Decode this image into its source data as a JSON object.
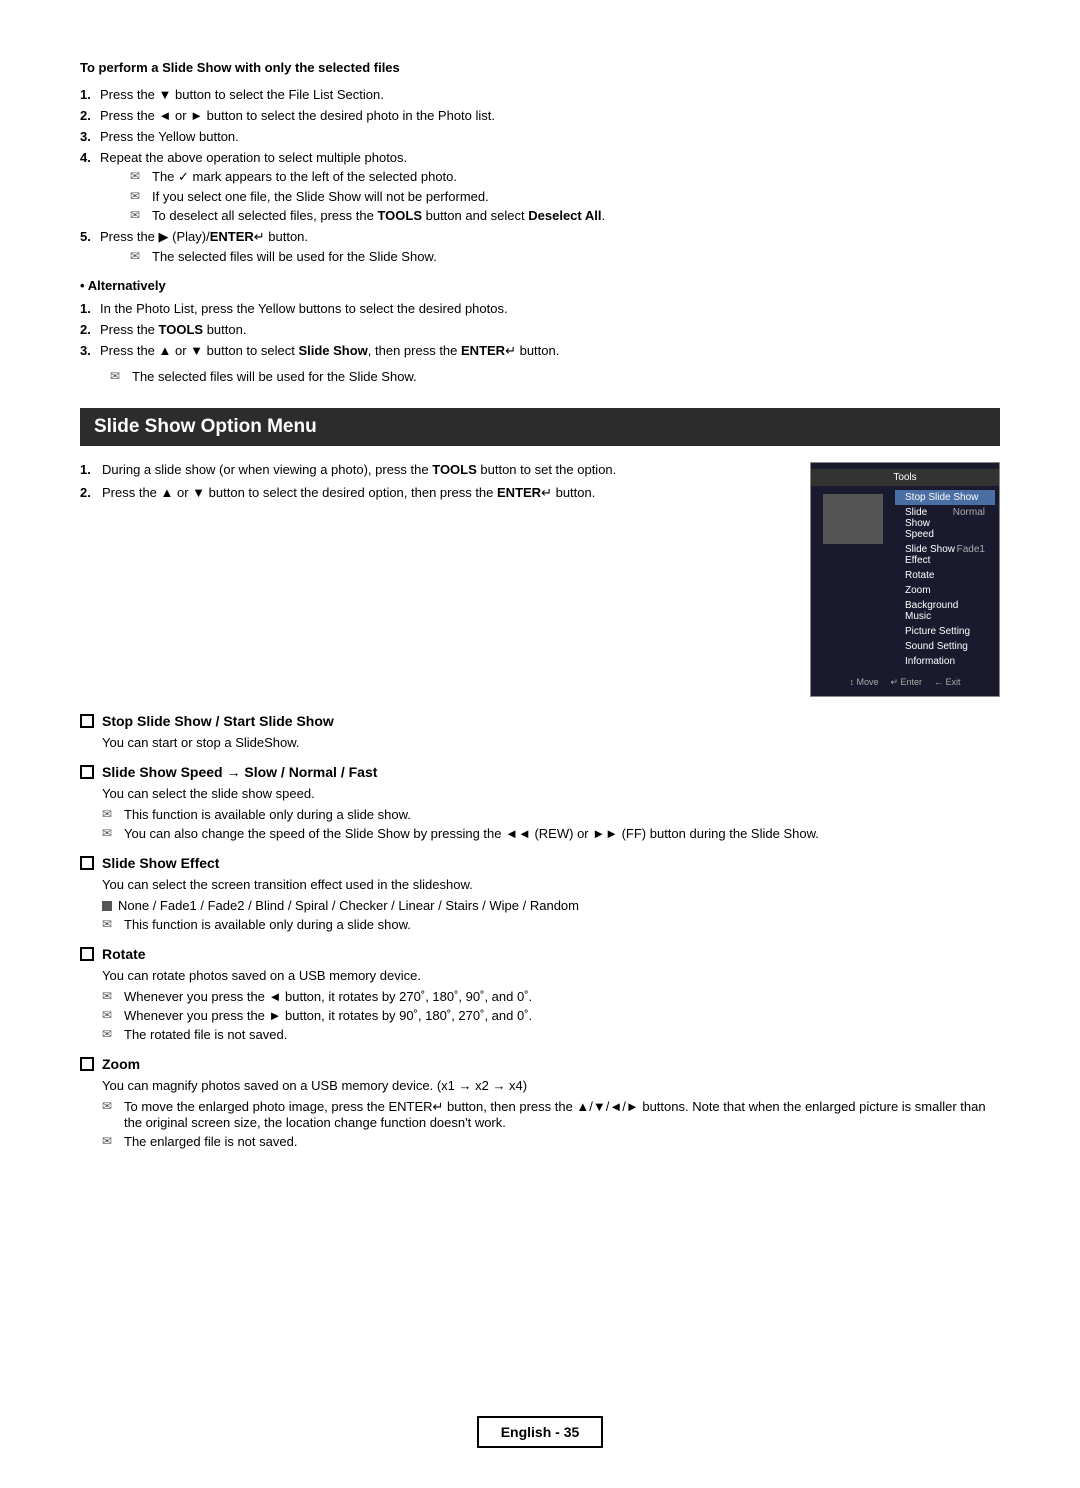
{
  "page": {
    "title": "Slide Show Option Menu",
    "section_header": "To perform a Slide Show with only the selected files",
    "footer_text": "English - 35"
  },
  "intro_steps": [
    {
      "num": "1",
      "text": "Press the ▼ button to select the File List Section."
    },
    {
      "num": "2",
      "text": "Press the ◄ or ► button to select the desired photo in the Photo list."
    },
    {
      "num": "3",
      "text": "Press the Yellow button."
    },
    {
      "num": "4",
      "text": "Repeat the above operation to select multiple photos.",
      "notes": [
        "The ✓ mark appears to the left of the selected photo.",
        "If you select one file, the Slide Show will not be performed.",
        "To deselect all selected files, press the TOOLS button and select Deselect All."
      ]
    },
    {
      "num": "5",
      "text": "Press the ▶ (Play)/ENTER↵ button.",
      "notes": [
        "The selected files will be used for the Slide Show."
      ]
    }
  ],
  "alternatively": {
    "label": "Alternatively",
    "steps": [
      {
        "num": "1",
        "text": "In the Photo List, press the Yellow buttons to select the desired photos."
      },
      {
        "num": "2",
        "text": "Press the TOOLS button."
      },
      {
        "num": "3",
        "text": "Press the ▲ or ▼ button to select Slide Show, then press the ENTER↵ button."
      }
    ],
    "note": "The selected files will be used for the Slide Show."
  },
  "slideshow_section": {
    "title": "Slide Show Option Menu",
    "steps": [
      {
        "num": "1",
        "text": "During a slide show (or when viewing a photo), press the TOOLS button to set the option."
      },
      {
        "num": "2",
        "text": "Press the ▲ or ▼ button to select the desired option, then press the ENTER↵ button."
      }
    ]
  },
  "tools_menu": {
    "title": "Tools",
    "items": [
      {
        "label": "Stop Slide Show",
        "value": "",
        "selected": true
      },
      {
        "label": "Slide Show Speed",
        "value": "Normal",
        "selected": false
      },
      {
        "label": "Slide Show Effect",
        "value": "Fade1",
        "selected": false
      },
      {
        "label": "Rotate",
        "value": "",
        "selected": false
      },
      {
        "label": "Zoom",
        "value": "",
        "selected": false
      },
      {
        "label": "Background Music",
        "value": "",
        "selected": false
      },
      {
        "label": "Picture Setting",
        "value": "",
        "selected": false
      },
      {
        "label": "Sound Setting",
        "value": "",
        "selected": false
      },
      {
        "label": "Information",
        "value": "",
        "selected": false
      }
    ],
    "footer": [
      "↕ Move",
      "↵ Enter",
      "← Exit"
    ]
  },
  "subsections": [
    {
      "id": "stop_start",
      "header": "Stop Slide Show / Start Slide Show",
      "body": "You can start or stop a SlideShow.",
      "notes": []
    },
    {
      "id": "speed",
      "header": "Slide Show Speed → Slow / Normal / Fast",
      "body": "You can select the slide show speed.",
      "notes": [
        "This function is available only during a slide show.",
        "You can also change the speed of the Slide Show by pressing the ◄◄ (REW) or ►► (FF) button during the Slide Show."
      ]
    },
    {
      "id": "effect",
      "header": "Slide Show Effect",
      "body": "You can select the screen transition effect used in the slideshow.",
      "effects_line": "None / Fade1 / Fade2 / Blind / Spiral / Checker / Linear / Stairs / Wipe / Random",
      "effects_note": "This function is available only during a slide show."
    },
    {
      "id": "rotate",
      "header": "Rotate",
      "body": "You can rotate photos saved on a USB memory device.",
      "notes": [
        "Whenever you press the ◄ button, it rotates by 270˚, 180˚, 90˚, and 0˚.",
        "Whenever you press the ► button, it rotates by 90˚, 180˚, 270˚, and 0˚.",
        "The rotated file is not saved."
      ]
    },
    {
      "id": "zoom",
      "header": "Zoom",
      "body": "You can magnify photos saved on a USB memory device. (x1 → x2 → x4)",
      "notes": [
        "To move the enlarged photo image, press the ENTER↵ button, then press the ▲/▼/◄/► buttons. Note that when the enlarged picture is smaller than the original screen size, the location change function doesn't work.",
        "The enlarged file is not saved."
      ]
    }
  ]
}
